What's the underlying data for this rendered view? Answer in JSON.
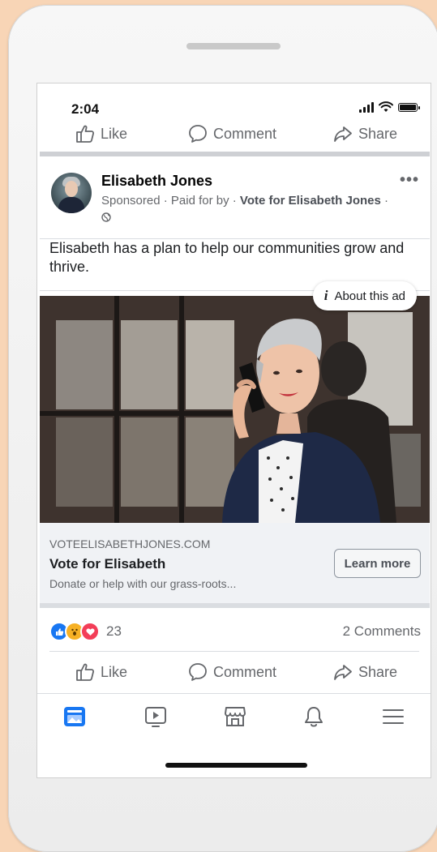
{
  "status_bar": {
    "time": "2:04"
  },
  "top_actions": {
    "like": "Like",
    "comment": "Comment",
    "share": "Share"
  },
  "post": {
    "author": "Elisabeth Jones",
    "sponsored": "Sponsored · Paid for by · ",
    "paid_for": "Vote for Elisabeth Jones",
    "meta_suffix": " · ",
    "more_label": "•••",
    "text": "Elisabeth has a plan to help our communities grow and thrive.",
    "about_ad": "About this ad",
    "about_icon": "i"
  },
  "link_card": {
    "domain": "VOTEELISABETHJONES.COM",
    "headline": "Vote for Elisabeth",
    "description": "Donate or help with our grass-roots...",
    "cta": "Learn more"
  },
  "engagement": {
    "reaction_count": "23",
    "comments": "2 Comments",
    "reactions": [
      "like-icon",
      "wow-icon",
      "love-icon"
    ]
  },
  "actions": {
    "like": "Like",
    "comment": "Comment",
    "share": "Share"
  },
  "bottom_nav": {
    "items": [
      "news-feed-icon",
      "watch-icon",
      "marketplace-icon",
      "notifications-icon",
      "menu-icon"
    ],
    "active_color": "#1877f2"
  },
  "colors": {
    "brand": "#1877f2",
    "background": "#f8d5b6"
  }
}
